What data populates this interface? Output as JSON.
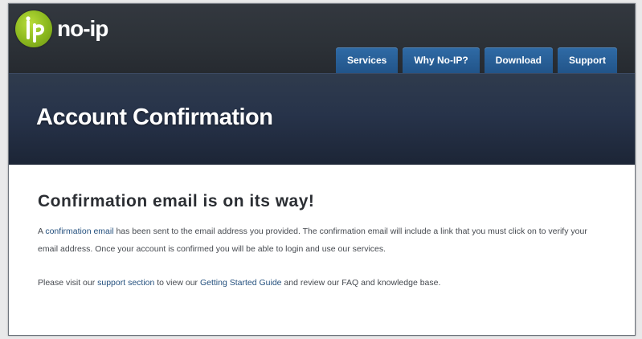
{
  "brand": {
    "logo_text": "no-ip"
  },
  "nav": {
    "items": [
      {
        "label": "Services"
      },
      {
        "label": "Why No-IP?"
      },
      {
        "label": "Download"
      },
      {
        "label": "Support"
      }
    ]
  },
  "hero": {
    "title": "Account Confirmation"
  },
  "content": {
    "heading": "Confirmation email is on its way!",
    "para1": {
      "prefix": "A ",
      "link": "confirmation email",
      "suffix": " has been sent to the email address you provided. The confirmation email will include a link that you must click on to verify your email address. Once your account is confirmed you will be able to login and use our services."
    },
    "para2": {
      "prefix": "Please visit our ",
      "link1": "support section",
      "middle": " to view our ",
      "link2": "Getting Started Guide",
      "suffix": " and review our FAQ and knowledge base."
    }
  },
  "colors": {
    "nav_button": "#2a5f98",
    "hero_bg": "#27334a",
    "logo_green": "#8ab81e",
    "link": "#24507e"
  }
}
